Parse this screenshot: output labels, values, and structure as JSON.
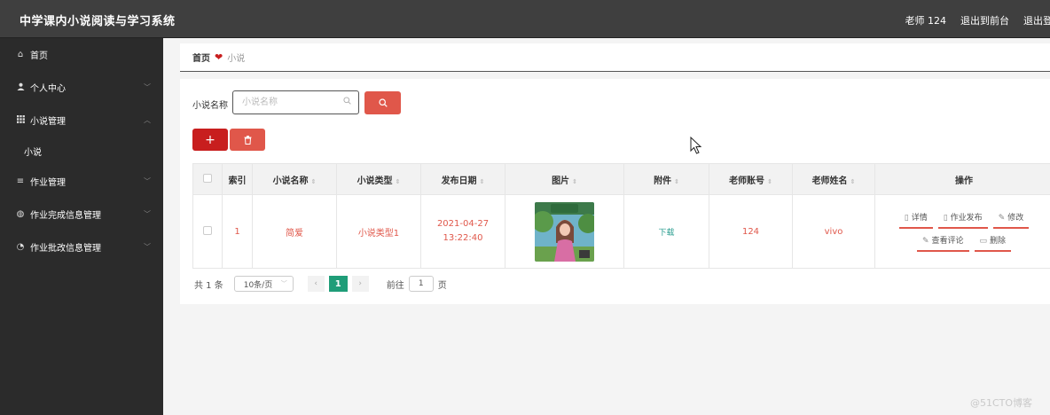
{
  "app": {
    "title": "中学课内小说阅读与学习系统"
  },
  "header": {
    "user": "老师 124",
    "to_front": "退出到前台",
    "logout": "退出登录"
  },
  "sidebar": {
    "items": [
      {
        "label": "首页",
        "icon": "home-icon"
      },
      {
        "label": "个人中心",
        "icon": "user-icon"
      },
      {
        "label": "小说管理",
        "icon": "grid-icon"
      },
      {
        "label": "作业管理",
        "icon": "list-icon"
      },
      {
        "label": "作业完成信息管理",
        "icon": "globe-icon"
      },
      {
        "label": "作业批改信息管理",
        "icon": "compass-icon"
      }
    ],
    "sub_items": [
      {
        "label": "小说"
      }
    ]
  },
  "breadcrumb": {
    "home": "首页",
    "current": "小说"
  },
  "search": {
    "label": "小说名称",
    "placeholder": "小说名称"
  },
  "table": {
    "headers": [
      "索引",
      "小说名称",
      "小说类型",
      "发布日期",
      "图片",
      "附件",
      "老师账号",
      "老师姓名",
      "操作"
    ],
    "rows": [
      {
        "index": "1",
        "name": "简爱",
        "type": "小说类型1",
        "date": "2021-04-27 13:22:40",
        "attachment": "下载",
        "teacher_account": "124",
        "teacher_name": "vivo"
      }
    ],
    "actions": [
      "详情",
      "作业发布",
      "修改",
      "查看评论",
      "删除"
    ]
  },
  "pagination": {
    "total": "共 1 条",
    "page_size": "10条/页",
    "current": "1",
    "goto_label": "前往",
    "goto_value": "1",
    "page_unit": "页"
  },
  "watermark": "@51CTO博客",
  "colors": {
    "topbar": "#3f3f3f",
    "sidebar": "#2b2b2b",
    "primary": "#c81e1e",
    "accent": "#e0574a",
    "page_active": "#1f9d78"
  }
}
